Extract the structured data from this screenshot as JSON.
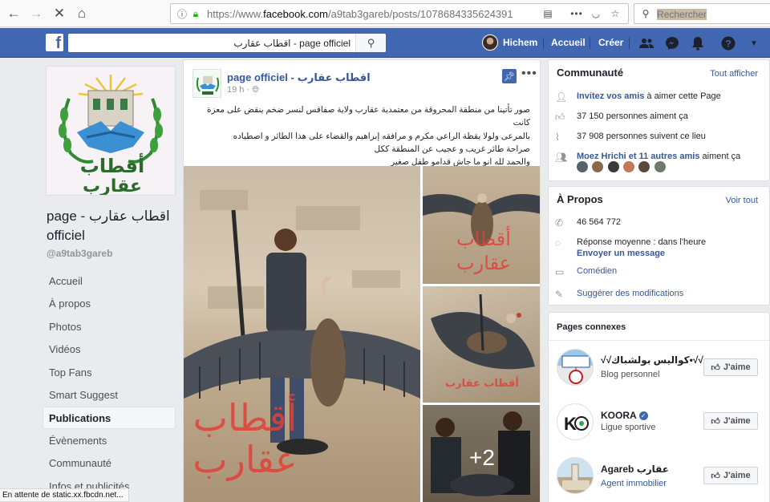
{
  "browser": {
    "url_prefix": "https://www.",
    "url_domain": "facebook.com",
    "url_path": "/a9tab3gareb/posts/1078684335624391",
    "search_placeholder": "Rechercher"
  },
  "fb_header": {
    "search_value": "page officiel - اقطاب عقارب",
    "user_name": "Hichem",
    "nav_home": "Accueil",
    "nav_create": "Créer"
  },
  "left": {
    "logo_text_line1": "أقطاب",
    "logo_text_line2": "عقارب",
    "page_name": "page - اقطاب عقارب officiel",
    "handle": "@a9tab3gareb",
    "menu": [
      {
        "label": "Accueil"
      },
      {
        "label": "À propos"
      },
      {
        "label": "Photos"
      },
      {
        "label": "Vidéos"
      },
      {
        "label": "Top Fans"
      },
      {
        "label": "Smart Suggest"
      },
      {
        "label": "Publications"
      },
      {
        "label": "Évènements"
      },
      {
        "label": "Communauté"
      },
      {
        "label": "Infos et publicités"
      }
    ]
  },
  "post": {
    "author": "page officiel -",
    "author_ar": "اقطاب عقارب",
    "time": "19 h ·",
    "text_lines": [
      "صور تأتينا من منطقة المحروقة من معتمدية عقارب ولاية صفاقس لنسر ضخم ينقض على معزة كانت",
      "بالمرعى ولولا يقظة الراعي مكرم و مرافقه إبراهيم والقضاء على هذا الطائر و اصطياده",
      "صراحة طائر غريب و عجيب عن المنطقة ككل",
      "والحمد لله انو ما جاش قدامو طفل صغير"
    ],
    "watermark_line1": "أقطاب",
    "watermark_line2": "عقارب",
    "small_watermark_line1": "أقطاب",
    "small_watermark_line2": "عقارب",
    "small_watermark_single": "أقطاب عقارب",
    "more_photos": "+2"
  },
  "community": {
    "title": "Communauté",
    "see_all": "Tout afficher",
    "invite_link": "Invitez vos amis",
    "invite_rest": " à aimer cette Page",
    "likes": "37 150 personnes aiment ça",
    "follows": "37 908 personnes suivent ce lieu",
    "friends_link": "Moez Hrichi et 11 autres amis",
    "friends_rest": " aiment ça"
  },
  "about": {
    "title": "À Propos",
    "see_all": "Voir tout",
    "phone": "46 564 772",
    "response": "Réponse moyenne : dans l'heure",
    "send_message": "Envoyer un message",
    "category": "Comédien",
    "suggest": "Suggérer des modifications"
  },
  "related": {
    "title": "Pages connexes",
    "like_label": "J'aime",
    "pages": [
      {
        "name": "√√كواليس بولشباك•√√",
        "category": "Blog personnel"
      },
      {
        "name": "KOORA",
        "category": "Ligue sportive"
      },
      {
        "name": "Agareb عقارب",
        "category": "Agent immobilier"
      }
    ]
  },
  "status_text": "En attente de static.xx.fbcdn.net..."
}
